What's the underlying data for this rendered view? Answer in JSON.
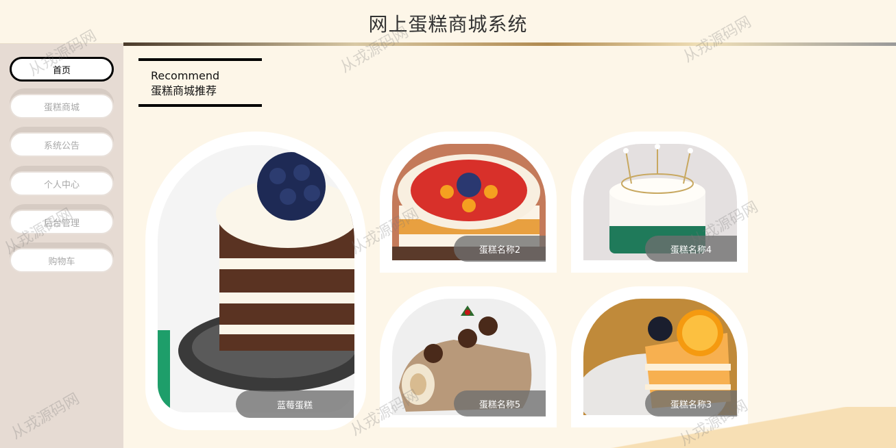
{
  "header": {
    "title": "网上蛋糕商城系统"
  },
  "sidebar": {
    "items": [
      {
        "label": "首页",
        "active": true
      },
      {
        "label": "蛋糕商城",
        "active": false
      },
      {
        "label": "系统公告",
        "active": false
      },
      {
        "label": "个人中心",
        "active": false
      },
      {
        "label": "后台管理",
        "active": false
      },
      {
        "label": "购物车",
        "active": false
      }
    ]
  },
  "recommend": {
    "english": "Recommend",
    "chinese": "蛋糕商城推荐"
  },
  "products": [
    {
      "name": "蓝莓蛋糕",
      "image": "blueberry-layer-cake"
    },
    {
      "name": "蛋糕名称2",
      "image": "fruit-cream-cake"
    },
    {
      "name": "蛋糕名称4",
      "image": "crown-pearl-cake"
    },
    {
      "name": "蛋糕名称5",
      "image": "chestnut-log-cake"
    },
    {
      "name": "蛋糕名称3",
      "image": "orange-mousse-slice"
    }
  ],
  "watermark": "从戎源码网",
  "colors": {
    "background": "#fdf6e8",
    "sidebar": "#e6dbd3",
    "accent_border": "#000000",
    "label_bg": "#6e6e6e"
  }
}
